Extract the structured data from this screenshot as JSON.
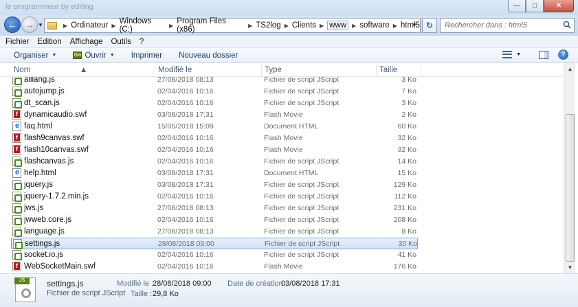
{
  "titlebar": {
    "faded_text": "le programmeur by editing"
  },
  "address": {
    "crumbs": [
      "Ordinateur",
      "Windows (C:)",
      "Program Files (x86)",
      "TS2log",
      "Clients",
      "www",
      "software",
      "html5"
    ],
    "boxed_index": 5
  },
  "search": {
    "placeholder": "Rechercher dans : html5"
  },
  "menu": [
    "Fichier",
    "Edition",
    "Affichage",
    "Outils",
    "?"
  ],
  "toolbar": {
    "organize": "Organiser",
    "open": "Ouvrir",
    "open_icon_text": "Dw",
    "print": "Imprimer",
    "new_folder": "Nouveau dossier"
  },
  "columns": {
    "name": "Nom",
    "modified": "Modifié le",
    "type": "Type",
    "size": "Taille"
  },
  "files": [
    {
      "name": "alllang.js",
      "modified": "27/08/2018 08:13",
      "type": "Fichier de script JScript",
      "size": "3 Ko",
      "icon": "js"
    },
    {
      "name": "autojump.js",
      "modified": "02/04/2016 10:16",
      "type": "Fichier de script JScript",
      "size": "7 Ko",
      "icon": "js"
    },
    {
      "name": "dt_scan.js",
      "modified": "02/04/2016 10:16",
      "type": "Fichier de script JScript",
      "size": "3 Ko",
      "icon": "js"
    },
    {
      "name": "dynamicaudio.swf",
      "modified": "03/08/2018 17:31",
      "type": "Flash Movie",
      "size": "2 Ko",
      "icon": "swf"
    },
    {
      "name": "faq.html",
      "modified": "15/05/2018 15:09",
      "type": "Document HTML",
      "size": "60 Ko",
      "icon": "html"
    },
    {
      "name": "flash9canvas.swf",
      "modified": "02/04/2016 10:16",
      "type": "Flash Movie",
      "size": "32 Ko",
      "icon": "swf"
    },
    {
      "name": "flash10canvas.swf",
      "modified": "02/04/2016 10:16",
      "type": "Flash Movie",
      "size": "32 Ko",
      "icon": "swf"
    },
    {
      "name": "flashcanvas.js",
      "modified": "02/04/2016 10:16",
      "type": "Fichier de script JScript",
      "size": "14 Ko",
      "icon": "js"
    },
    {
      "name": "help.html",
      "modified": "03/08/2018 17:31",
      "type": "Document HTML",
      "size": "15 Ko",
      "icon": "html"
    },
    {
      "name": "jquery.js",
      "modified": "03/08/2018 17:31",
      "type": "Fichier de script JScript",
      "size": "129 Ko",
      "icon": "js"
    },
    {
      "name": "jquery-1.7.2.min.js",
      "modified": "02/04/2016 10:16",
      "type": "Fichier de script JScript",
      "size": "112 Ko",
      "icon": "js"
    },
    {
      "name": "jws.js",
      "modified": "27/08/2018 08:13",
      "type": "Fichier de script JScript",
      "size": "231 Ko",
      "icon": "js"
    },
    {
      "name": "jwweb.core.js",
      "modified": "02/04/2016 10:16",
      "type": "Fichier de script JScript",
      "size": "208 Ko",
      "icon": "js"
    },
    {
      "name": "language.js",
      "modified": "27/08/2018 08:13",
      "type": "Fichier de script JScript",
      "size": "8 Ko",
      "icon": "js"
    },
    {
      "name": "settings.js",
      "modified": "28/08/2018 09:00",
      "type": "Fichier de script JScript",
      "size": "30 Ko",
      "icon": "js",
      "selected": true
    },
    {
      "name": "socket.io.js",
      "modified": "02/04/2016 10:16",
      "type": "Fichier de script JScript",
      "size": "41 Ko",
      "icon": "js"
    },
    {
      "name": "WebSocketMain.swf",
      "modified": "02/04/2016 10:16",
      "type": "Flash Movie",
      "size": "176 Ko",
      "icon": "swf"
    }
  ],
  "details": {
    "icon_text": "JS",
    "name": "settings.js",
    "type": "Fichier de script JScript",
    "modified_label": "Modifié le :",
    "modified_value": "28/08/2018 09:00",
    "size_label": "Taille :",
    "size_value": "29,8 Ko",
    "created_label": "Date de création :",
    "created_value": "03/08/2018 17:31"
  },
  "colors": {
    "selection": "#cfe2f8",
    "selection_border": "#7da2ce",
    "accent": "#1f5cb0"
  }
}
